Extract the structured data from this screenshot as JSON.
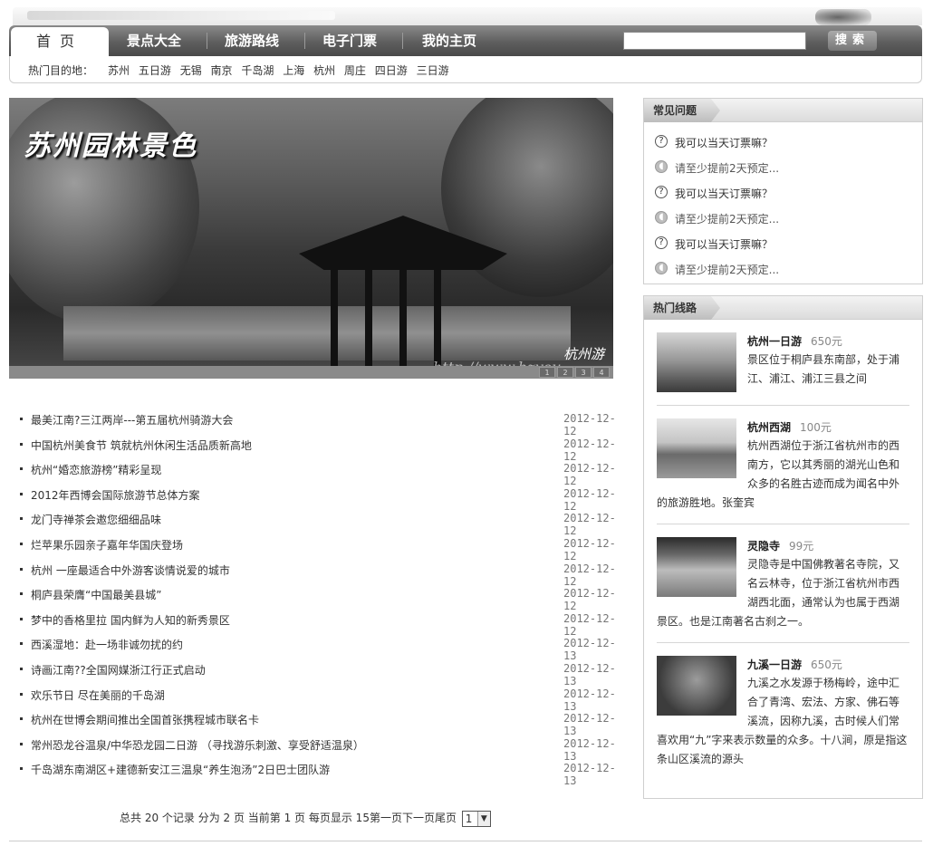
{
  "nav": {
    "tabs": [
      "首页",
      "景点大全",
      "旅游路线",
      "电子门票",
      "我的主页"
    ],
    "search_button": "搜索",
    "search_placeholder": ""
  },
  "hot": {
    "label": "热门目的地：",
    "links": [
      "苏州",
      "五日游",
      "无锡",
      "南京",
      "千岛湖",
      "上海",
      "杭州",
      "周庄",
      "四日游",
      "三日游"
    ]
  },
  "banner": {
    "title": "苏州园林景色",
    "brand": "杭州游",
    "url": "http://www.hzyou",
    "dots": [
      "1",
      "2",
      "3",
      "4"
    ]
  },
  "news": [
    {
      "title": "最美江南?三江两岸---第五届杭州骑游大会",
      "date": "2012-12-12"
    },
    {
      "title": "中国杭州美食节 筑就杭州休闲生活品质新高地",
      "date": "2012-12-12"
    },
    {
      "title": "杭州“婚恋旅游榜”精彩呈现",
      "date": "2012-12-12"
    },
    {
      "title": "2012年西博会国际旅游节总体方案",
      "date": "2012-12-12"
    },
    {
      "title": "龙门寺禅茶会邀您细细品味",
      "date": "2012-12-12"
    },
    {
      "title": "烂苹果乐园亲子嘉年华国庆登场",
      "date": "2012-12-12"
    },
    {
      "title": "杭州 一座最适合中外游客谈情说爱的城市",
      "date": "2012-12-12"
    },
    {
      "title": "桐庐县荣膺“中国最美县城”",
      "date": "2012-12-12"
    },
    {
      "title": "梦中的香格里拉 国内鲜为人知的新秀景区",
      "date": "2012-12-12"
    },
    {
      "title": "西溪湿地：赴一场非诚勿扰的约",
      "date": "2012-12-13"
    },
    {
      "title": "诗画江南??全国网媒浙江行正式启动",
      "date": "2012-12-13"
    },
    {
      "title": "欢乐节日 尽在美丽的千岛湖",
      "date": "2012-12-13"
    },
    {
      "title": "杭州在世博会期间推出全国首张携程城市联名卡",
      "date": "2012-12-13"
    },
    {
      "title": "常州恐龙谷温泉/中华恐龙园二日游 （寻找游乐刺激、享受舒适温泉）",
      "date": "2012-12-13"
    },
    {
      "title": "千岛湖东南湖区+建德新安江三温泉“养生泡汤”2日巴士团队游",
      "date": "2012-12-13"
    }
  ],
  "pager": {
    "text": "总共 20 个记录 分为 2 页 当前第 1 页 每页显示 15第一页下一页尾页",
    "selected": "1"
  },
  "faq": {
    "title": "常见问题",
    "items": [
      {
        "q": "我可以当天订票嘛？",
        "a": "请至少提前2天预定..."
      },
      {
        "q": "我可以当天订票嘛？",
        "a": "请至少提前2天预定..."
      },
      {
        "q": "我可以当天订票嘛？",
        "a": "请至少提前2天预定..."
      }
    ]
  },
  "routes": {
    "title": "热门线路",
    "items": [
      {
        "name": "杭州一日游",
        "price": "650元",
        "desc": "景区位于桐庐县东南部，处于浦江、浦江、浦江三县之间"
      },
      {
        "name": "杭州西湖",
        "price": "100元",
        "desc": "杭州西湖位于浙江省杭州市的西南方，它以其秀丽的湖光山色和众多的名胜古迹而成为闻名中外的旅游胜地。张奎宾"
      },
      {
        "name": "灵隐寺",
        "price": "99元",
        "desc": "灵隐寺是中国佛教著名寺院，又名云林寺，位于浙江省杭州市西湖西北面，通常认为也属于西湖景区。也是江南著名古刹之一。"
      },
      {
        "name": "九溪一日游",
        "price": "650元",
        "desc": "九溪之水发源于杨梅岭，途中汇合了青湾、宏法、方家、佛石等溪流，因称九溪，古时候人们常喜欢用“九”字来表示数量的众多。十八涧，原是指这条山区溪流的源头"
      }
    ]
  }
}
